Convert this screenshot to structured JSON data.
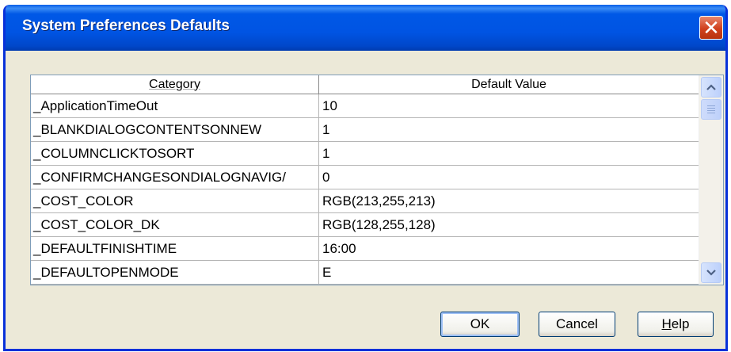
{
  "window": {
    "title": "System Preferences Defaults",
    "close_glyph": "✕"
  },
  "grid": {
    "columns": [
      "Category",
      "Default Value"
    ],
    "rows": [
      {
        "category": "_ApplicationTimeOut",
        "value": "10"
      },
      {
        "category": "_BLANKDIALOGCONTENTSONNEW",
        "value": "1"
      },
      {
        "category": "_COLUMNCLICKTOSORT",
        "value": "1"
      },
      {
        "category": "_CONFIRMCHANGESONDIALOGNAVIG/",
        "value": "0"
      },
      {
        "category": "_COST_COLOR",
        "value": "RGB(213,255,213)"
      },
      {
        "category": "_COST_COLOR_DK",
        "value": "RGB(128,255,128)"
      },
      {
        "category": "_DEFAULTFINISHTIME",
        "value": "16:00"
      },
      {
        "category": "_DEFAULTOPENMODE",
        "value": "E"
      }
    ]
  },
  "buttons": {
    "ok": "OK",
    "cancel": "Cancel",
    "help_mnemonic": "H",
    "help_rest": "elp"
  },
  "icons": {
    "close": "close-icon",
    "scroll_up": "chevron-up-icon",
    "scroll_down": "chevron-down-icon"
  },
  "colors": {
    "titlebar": "#0054e3",
    "close": "#d0401c",
    "dialog_bg": "#ece9d8"
  }
}
